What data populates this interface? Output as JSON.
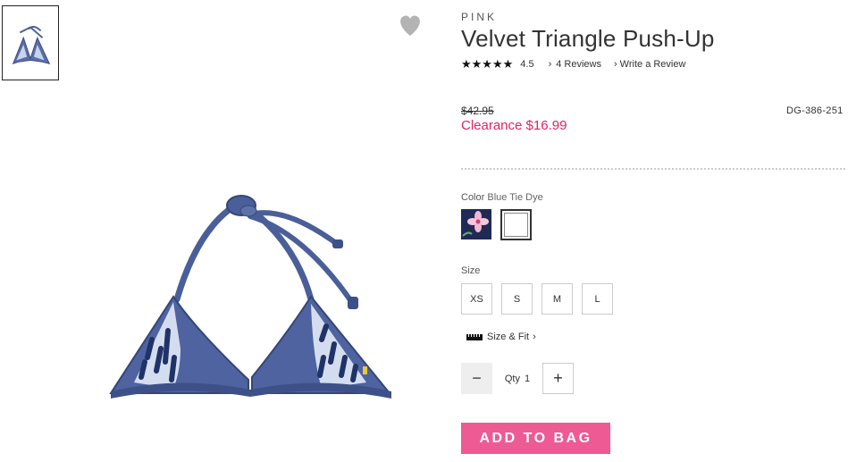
{
  "brand": "PINK",
  "product": {
    "title": "Velvet Triangle Push-Up",
    "stars": "★★★★★",
    "rating": "4.5",
    "reviews_label": "4 Reviews",
    "write_review_label": "Write a Review",
    "chevron": "›"
  },
  "price": {
    "was": "$42.95",
    "clearance": "Clearance $16.99",
    "sku": "DG-386-251"
  },
  "color": {
    "label": "Color",
    "value": "Blue Tie Dye"
  },
  "size": {
    "label": "Size",
    "options": [
      "XS",
      "S",
      "M",
      "L"
    ]
  },
  "size_fit_label": "Size & Fit",
  "quantity": {
    "minus": "−",
    "label": "Qty",
    "value": "1",
    "plus": "+"
  },
  "add_to_bag_label": "ADD TO BAG",
  "colors": {
    "clearance": "#e0245e",
    "button": "#ee5a94",
    "product_blue": "#4a5f99"
  }
}
